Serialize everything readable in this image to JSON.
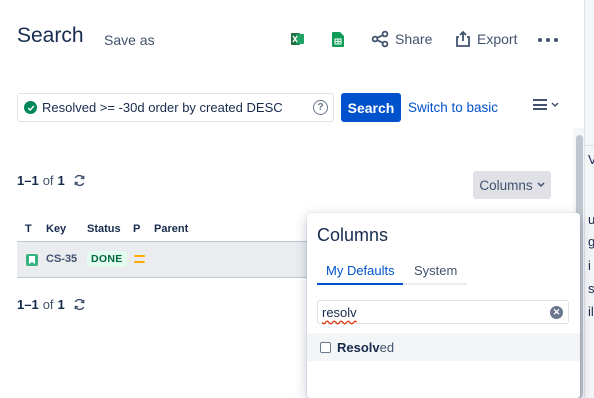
{
  "header": {
    "title": "Search",
    "save_as": "Save as",
    "share": "Share",
    "export": "Export",
    "excel_icon": "excel-icon",
    "sheets_icon": "google-sheets-icon"
  },
  "search": {
    "jql": "Resolved >= -30d order by created DESC",
    "search_button": "Search",
    "switch_basic": "Switch to basic"
  },
  "results": {
    "count_prefix": "1–1",
    "count_of": "of",
    "count_total": "1",
    "columns_button": "Columns",
    "headers": {
      "type": "T",
      "key": "Key",
      "status": "Status",
      "priority": "P",
      "parent": "Parent"
    },
    "rows": [
      {
        "key": "CS-35",
        "status": "DONE",
        "type_icon": "story-icon",
        "priority_icon": "medium-priority-icon"
      }
    ]
  },
  "columns_panel": {
    "title": "Columns",
    "tabs": [
      "My Defaults",
      "System"
    ],
    "active_tab": "My Defaults",
    "filter_value": "resolv",
    "options": [
      {
        "match": "Resolv",
        "rest": "ed",
        "checked": false
      }
    ]
  },
  "right_edge_fragments": [
    "V",
    "u",
    "g",
    "i",
    "s",
    "n",
    "il"
  ],
  "colors": {
    "primary": "#0052CC",
    "success": "#00875A",
    "done_lozenge_bg": "#E3FCEF",
    "done_lozenge_text": "#006644",
    "priority_medium": "#FFAB00"
  }
}
